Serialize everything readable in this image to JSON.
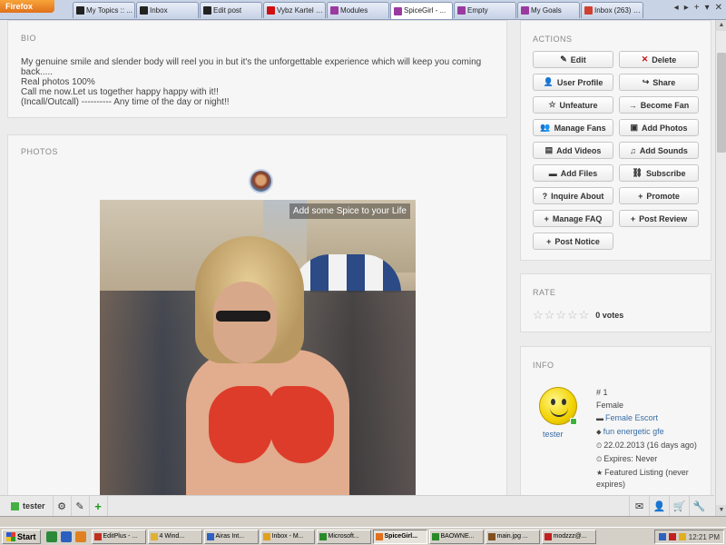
{
  "browser": {
    "app_button": "Firefox",
    "tabs": [
      {
        "label": "My Topics :: ...",
        "color": "#222222",
        "active": false
      },
      {
        "label": "Inbox",
        "color": "#222222",
        "active": false
      },
      {
        "label": "Edit post",
        "color": "#222222",
        "active": false
      },
      {
        "label": "Vybz Kartel - ...",
        "color": "#d01010",
        "active": false
      },
      {
        "label": "Modules",
        "color": "#9a3aa0",
        "active": false
      },
      {
        "label": "SpiceGirl - ...",
        "color": "#9a3aa0",
        "active": true
      },
      {
        "label": "Empty",
        "color": "#9a3aa0",
        "active": false
      },
      {
        "label": "My Goals",
        "color": "#9a3aa0",
        "active": false
      },
      {
        "label": "Inbox (263) - ...",
        "color": "#d04030",
        "active": false
      }
    ],
    "controls": [
      "◂",
      "▸",
      "+",
      "▾",
      "✕"
    ]
  },
  "bio": {
    "title": "BIO",
    "lines": [
      "My genuine smile and slender body will reel you in but it's the unforgettable experience which will keep you coming",
      "back.....",
      "Real photos 100%",
      "Call me now.Let us together happy happy with it!!",
      "(Incall/Outcall) ---------- Any time of the day or night!!"
    ]
  },
  "photos": {
    "title": "PHOTOS",
    "overlay_text": "Add some Spice to your Life"
  },
  "actions": {
    "title": "ACTIONS",
    "buttons": [
      {
        "icon": "✎",
        "label": "Edit",
        "red": false
      },
      {
        "icon": "✕",
        "label": "Delete",
        "red": true
      },
      {
        "icon": "👤",
        "label": "User Profile",
        "red": false
      },
      {
        "icon": "↪",
        "label": "Share",
        "red": false
      },
      {
        "icon": "☆",
        "label": "Unfeature",
        "red": false
      },
      {
        "icon": "→",
        "label": "Become Fan",
        "red": false
      },
      {
        "icon": "👥",
        "label": "Manage Fans",
        "red": false
      },
      {
        "icon": "▣",
        "label": "Add Photos",
        "red": false
      },
      {
        "icon": "▤",
        "label": "Add Videos",
        "red": false
      },
      {
        "icon": "♫",
        "label": "Add Sounds",
        "red": false
      },
      {
        "icon": "▬",
        "label": "Add Files",
        "red": false
      },
      {
        "icon": "⛓",
        "label": "Subscribe",
        "red": false
      },
      {
        "icon": "?",
        "label": "Inquire About",
        "red": false
      },
      {
        "icon": "+",
        "label": "Promote",
        "red": false
      },
      {
        "icon": "+",
        "label": "Manage FAQ",
        "red": false
      },
      {
        "icon": "+",
        "label": "Post Review",
        "red": false
      },
      {
        "icon": "+",
        "label": "Post Notice",
        "red": false
      }
    ]
  },
  "rate": {
    "title": "RATE",
    "stars": 5,
    "votes": "0 votes"
  },
  "info": {
    "title": "INFO",
    "username": "tester",
    "rows": [
      {
        "icon": "",
        "text": "# 1",
        "link": false
      },
      {
        "icon": "",
        "text": "Female",
        "link": false
      },
      {
        "icon": "▬",
        "text": "Female Escort",
        "link": true
      },
      {
        "icon": "⬥",
        "text": "fun energetic gfe",
        "link": true
      },
      {
        "icon": "⏲",
        "text": "22.02.2013 (16 days ago)",
        "link": false
      },
      {
        "icon": "⏲",
        "text": "Expires: Never",
        "link": false
      },
      {
        "icon": "★",
        "text": "Featured Listing (never expires)",
        "link": false
      }
    ]
  },
  "bottombar": {
    "user": "tester",
    "left_icons": [
      "⚙",
      "✎",
      "+"
    ],
    "right_icons": [
      "✉",
      "👤",
      "🛒",
      "🔧"
    ]
  },
  "taskbar": {
    "start": "Start",
    "tasks": [
      {
        "label": "EditPlus - ...",
        "color": "#c03020",
        "active": false
      },
      {
        "label": "4 Wind...",
        "color": "#e0b030",
        "active": false
      },
      {
        "label": "Airas Int...",
        "color": "#3060c0",
        "active": false
      },
      {
        "label": "Inbox - M...",
        "color": "#e0a020",
        "active": false
      },
      {
        "label": "Microsoft...",
        "color": "#2a8a2a",
        "active": false
      },
      {
        "label": "SpiceGirl...",
        "color": "#e07020",
        "active": true
      },
      {
        "label": "BAOWNE...",
        "color": "#2a8a2a",
        "active": false
      },
      {
        "label": "main.jpg ...",
        "color": "#805020",
        "active": false
      },
      {
        "label": "modzzz@...",
        "color": "#c02020",
        "active": false
      }
    ],
    "clock": "12:21 PM"
  }
}
